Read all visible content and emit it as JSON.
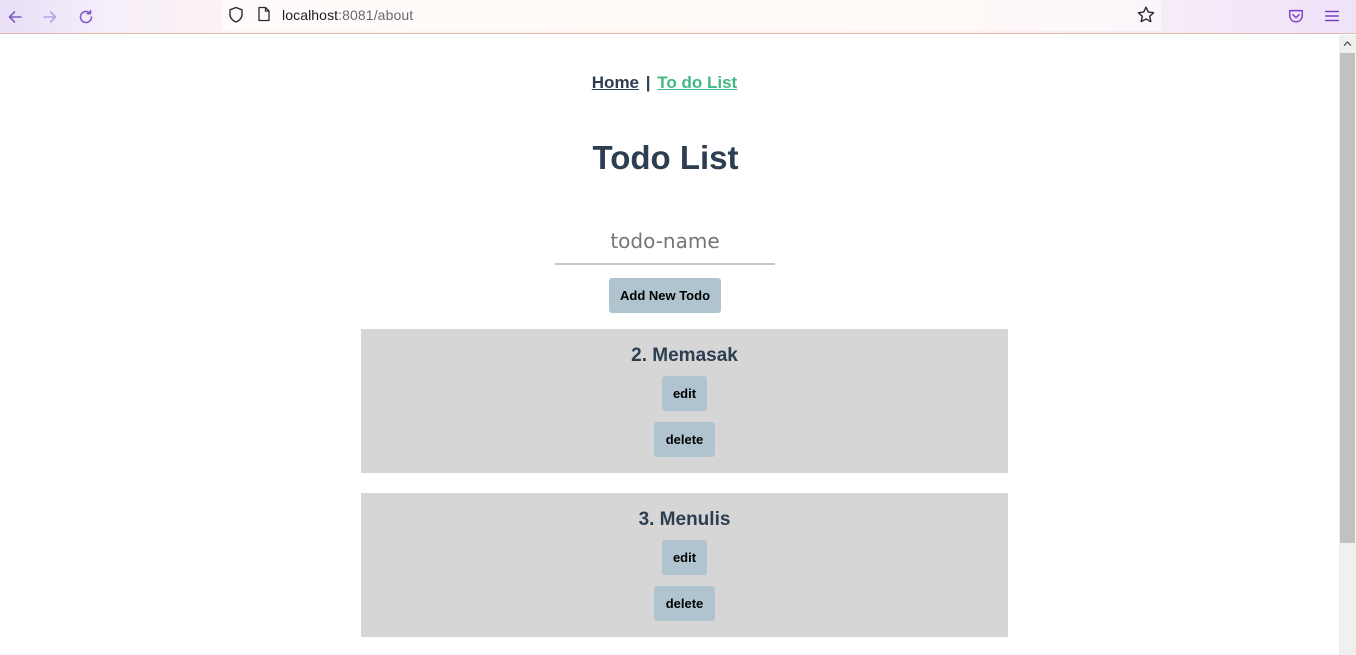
{
  "browser": {
    "url_host": "localhost",
    "url_path": ":8081/about"
  },
  "nav": {
    "home_label": "Home",
    "separator": "|",
    "todo_label": "To do List"
  },
  "title": "Todo List",
  "form": {
    "input_placeholder": "todo-name",
    "input_value": "",
    "add_button_label": "Add New Todo"
  },
  "todos": [
    {
      "label": "2. Memasak",
      "edit_label": "edit",
      "delete_label": "delete"
    },
    {
      "label": "3. Menulis",
      "edit_label": "edit",
      "delete_label": "delete"
    }
  ],
  "colors": {
    "text": "#2c3e50",
    "active_link": "#42b983",
    "button_bg": "#b0c4d0",
    "card_bg": "#d6d6d6"
  }
}
